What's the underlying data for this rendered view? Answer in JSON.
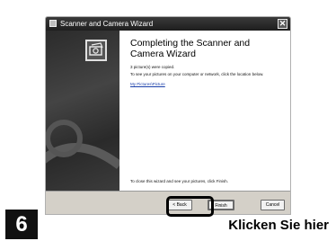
{
  "window": {
    "title": "Scanner and Camera Wizard",
    "close_glyph": "✕"
  },
  "content": {
    "heading": "Completing the Scanner and Camera Wizard",
    "copied_text": "3 picture(s) were copied.",
    "see_text": "To see your pictures on your computer or network, click the location below.",
    "location_link": "My Pictures\\Picture",
    "close_text": "To close this wizard and see your pictures, click Finish."
  },
  "buttons": {
    "back": "< Back",
    "finish": "Finish",
    "cancel": "Cancel"
  },
  "instruction": {
    "step_number": "6",
    "caption": "Klicken Sie hier"
  },
  "icons": {
    "app": "scanner-camera-icon",
    "wizard": "camera-photo-icon"
  }
}
